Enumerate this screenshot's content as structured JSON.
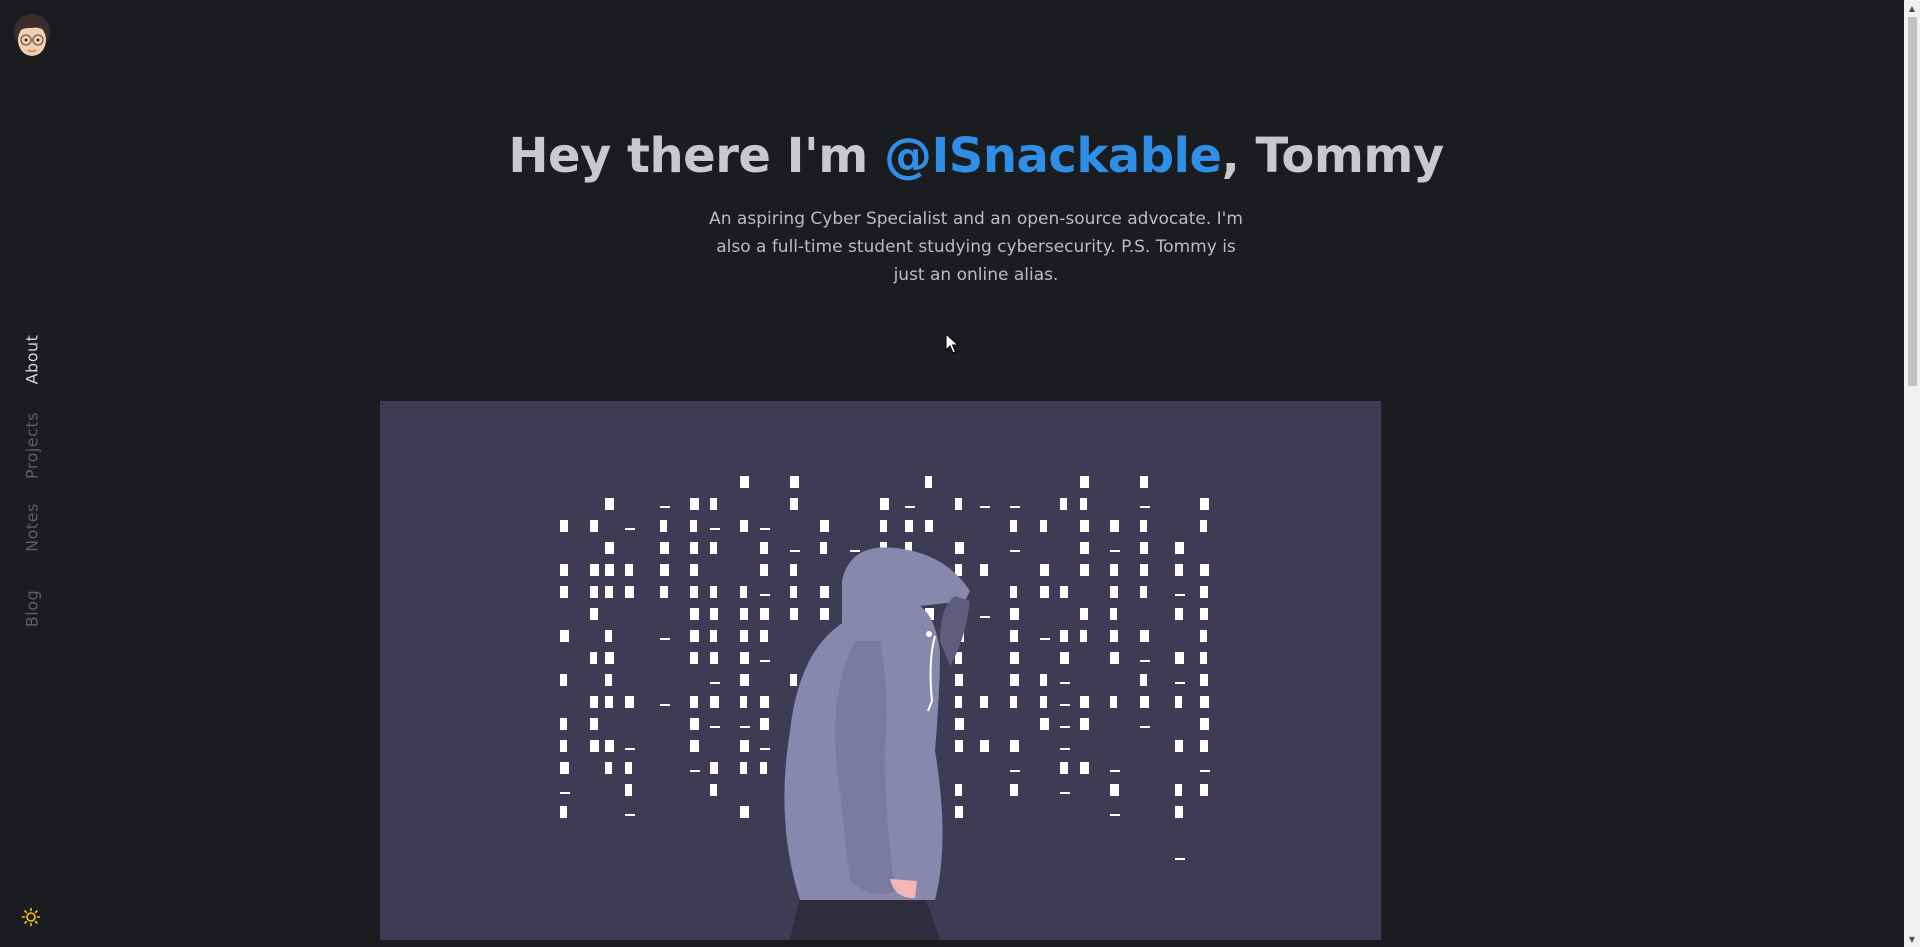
{
  "nav": {
    "items": [
      {
        "label": "About",
        "active": true
      },
      {
        "label": "Projects",
        "active": false
      },
      {
        "label": "Notes",
        "active": false
      },
      {
        "label": "Blog",
        "active": false
      }
    ]
  },
  "hero": {
    "title_prefix": "Hey there I'm ",
    "handle": "@ISnackable",
    "title_suffix": ", Tommy",
    "subtitle": "An aspiring Cyber Specialist and an open-source advocate. I'm also a full-time student studying cybersecurity. P.S. Tommy is just an online alias."
  },
  "icons": {
    "avatar": "memoji-avatar",
    "theme_toggle": "sun-icon",
    "scroll_up": "arrow-up-icon",
    "scroll_down": "arrow-down-icon"
  },
  "colors": {
    "background": "#1b1c1f",
    "accent": "#2f8fe7",
    "heading": "#c7c9cc",
    "illustration_bg": "#3e3c55",
    "hoodie": "#8a87ad",
    "theme_icon": "#f5c518"
  }
}
